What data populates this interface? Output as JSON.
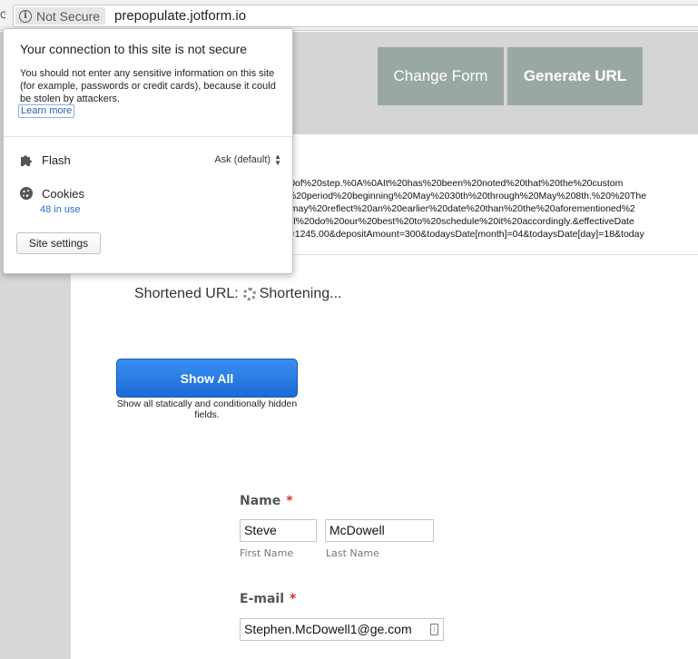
{
  "address_bar": {
    "security_label": "Not Secure",
    "url": "prepopulate.jotform.io"
  },
  "toolbar": {
    "change_form_label": "Change Form",
    "generate_url_label": "Generate URL"
  },
  "generated_url": {
    "lines": [
      "ide%20of%20step.%0A%0AIt%20has%20been%20noted%20that%20the%20custom",
      "%20a%20period%20beginning%20May%2030th%20through%20May%208th.%20%20The",
      "nt%20may%20reflect%20an%20earlier%20date%20than%20the%20aforementioned%2",
      "%20will%20do%20our%20best%20to%20schedule%20it%20accordingly.&effectiveDate",
      "nce66=1245.00&depositAmount=300&todaysDate[month]=04&todaysDate[day]=18&today"
    ]
  },
  "shortened": {
    "label": "Shortened URL:",
    "status": "Shortening..."
  },
  "show_all": {
    "label": "Show All",
    "caption": "Show all statically and conditionally hidden fields."
  },
  "form": {
    "name_label": "Name",
    "required_mark": "*",
    "first_name_value": "Steve",
    "last_name_value": "McDowell",
    "first_name_sublabel": "First Name",
    "last_name_sublabel": "Last Name",
    "email_label": "E-mail",
    "email_value": "Stephen.McDowell1@ge.com"
  },
  "site_popup": {
    "title": "Your connection to this site is not secure",
    "description": "You should not enter any sensitive information on this site (for example, passwords or credit cards), because it could be stolen by attackers.",
    "learn_more": "Learn more",
    "flash_label": "Flash",
    "flash_value": "Ask (default)",
    "cookies_label": "Cookies",
    "cookies_count": "48 in use",
    "site_settings_label": "Site settings"
  },
  "icons": {
    "info": "info-icon",
    "flash": "puzzle-piece-icon",
    "cookies": "cookie-icon",
    "spinner": "spinner-icon",
    "select": "up-down-chevron-icon",
    "autofill": "contact-card-icon"
  }
}
